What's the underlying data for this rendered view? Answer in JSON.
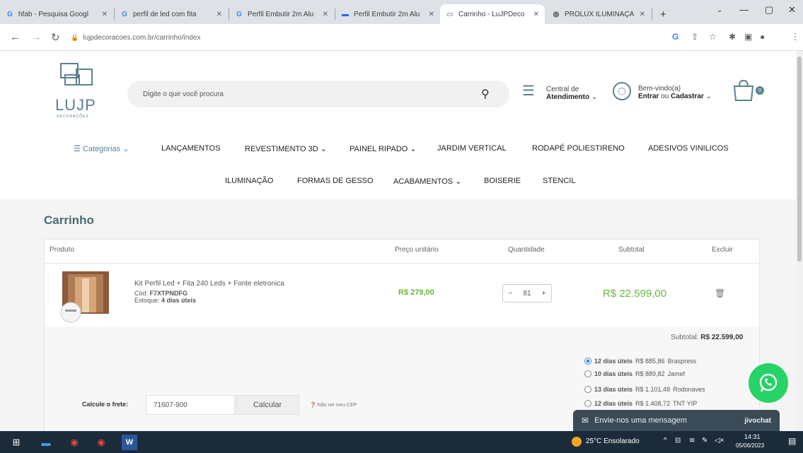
{
  "browser": {
    "tabs": [
      {
        "title": "hfab - Pesquisa Googl",
        "favicon": "G",
        "favicon_color": "#4285f4",
        "active": false
      },
      {
        "title": "perfil de led com fita",
        "favicon": "G",
        "favicon_color": "#4285f4",
        "active": false
      },
      {
        "title": "Perfil Embutir 2m Alu",
        "favicon": "G",
        "favicon_color": "#4285f4",
        "active": false
      },
      {
        "title": "Perfil Embutir 2m Alu",
        "favicon": "▬",
        "favicon_color": "#1a73e8",
        "active": false
      },
      {
        "title": "Carrinho - LuJPDeco",
        "favicon": "▭",
        "favicon_color": "#9aa0a6",
        "active": true
      },
      {
        "title": "PROLUX ILUMINAÇÃ",
        "favicon": "◍",
        "favicon_color": "#5f6368",
        "active": false
      }
    ],
    "new_tab": "+",
    "url": "lujpdecoracoes.com.br/carrinho/index"
  },
  "header": {
    "logo_text": "LUJP",
    "logo_sub": "DECORAÇÕES",
    "search_placeholder": "Digite o que você procura",
    "service_line1": "Central de",
    "service_line2": "Atendimento",
    "welcome_line1": "Bem-vindo(a)",
    "welcome_enter": "Entrar",
    "welcome_or": "ou",
    "welcome_register": "Cadastrar",
    "cart_count": "0"
  },
  "nav": {
    "row1": [
      {
        "label": "Categorias",
        "caret": true,
        "accent": true
      },
      {
        "label": "LANÇAMENTOS",
        "caret": false
      },
      {
        "label": "REVESTIMENTO 3D",
        "caret": true
      },
      {
        "label": "PAINEL RIPADO",
        "caret": true
      },
      {
        "label": "JARDIM VERTICAL",
        "caret": false
      },
      {
        "label": "RODAPÉ POLIESTIRENO",
        "caret": false
      },
      {
        "label": "ADESIVOS VINILICOS",
        "caret": false
      }
    ],
    "row2": [
      {
        "label": "ILUMINAÇÃO",
        "caret": false
      },
      {
        "label": "FORMAS DE GESSO",
        "caret": false
      },
      {
        "label": "ACABAMENTOS",
        "caret": true
      },
      {
        "label": "BOISERIE",
        "caret": false
      },
      {
        "label": "STENCIL",
        "caret": false
      }
    ]
  },
  "cart": {
    "title": "Carrinho",
    "columns": {
      "product": "Produto",
      "unit_price": "Preço unitário",
      "quantity": "Quantidade",
      "subtotal": "Subtotal",
      "remove": "Excluir"
    },
    "item": {
      "name": "Kit Perfil Led + Fita 240 Leds + Fonte eletronica",
      "code_label": "Cód:",
      "code": "F7XTPNDFG",
      "stock_label": "Estoque:",
      "stock": "4 dias úteis",
      "unit_price": "R$ 279,00",
      "quantity": "81",
      "subtotal": "R$ 22.599,00"
    },
    "subtotal_label": "Subtotal:",
    "subtotal_value": "R$ 22.599,00",
    "shipping_label": "Calcule o frete:",
    "cep_value": "71607-900",
    "calc_button": "Calcular",
    "dont_know_cep": "Não sei meu CEP",
    "shipping_options": [
      {
        "days": "12 dias úteis",
        "price": "R$ 885,86",
        "carrier": "Braspress",
        "selected": true
      },
      {
        "days": "10 dias úteis",
        "price": "R$ 889,82",
        "carrier": "Jamef",
        "selected": false
      },
      {
        "days": "13 dias úteis",
        "price": "R$ 1.101,48",
        "carrier": "Rodonaves",
        "selected": false
      },
      {
        "days": "12 dias úteis",
        "price": "R$ 1.408,72",
        "carrier": "TNT YIP",
        "selected": false
      }
    ]
  },
  "chat": {
    "message": "Envie-nos uma mensagem",
    "brand": "jivochat"
  },
  "taskbar": {
    "weather": "25°C  Ensolarado",
    "time": "14:31",
    "date": "05/06/2023"
  },
  "colors": {
    "accent_teal": "#456a76",
    "price_green": "#69b83d",
    "whatsapp": "#25d366",
    "taskbar": "#1c2b3a"
  }
}
